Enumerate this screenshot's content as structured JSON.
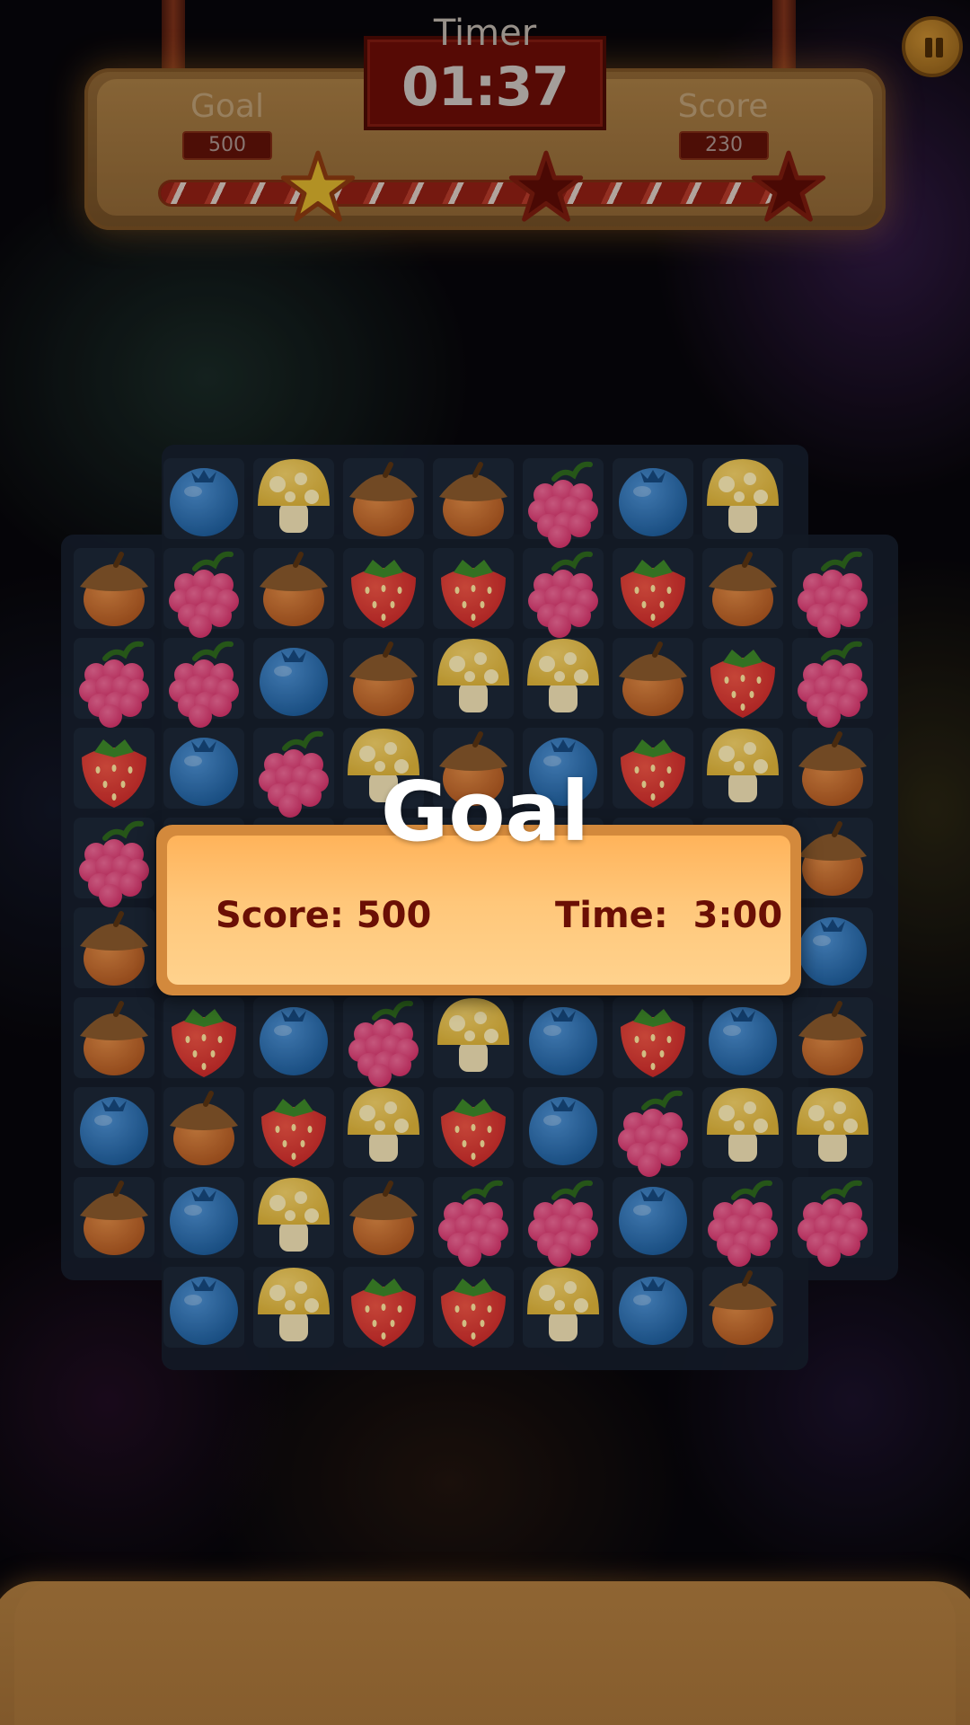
{
  "hud": {
    "timer_label": "Timer",
    "timer_value": "01:37",
    "goal_label": "Goal",
    "goal_value": "500",
    "score_label": "Score",
    "score_value": "230",
    "stars_earned": 1,
    "stars_total": 3
  },
  "overlay": {
    "title": "Goal",
    "score_text": "Score: 500",
    "time_text": "Time:  3:00"
  },
  "board": {
    "rows": [
      [
        null,
        "blueberry",
        "mushroom",
        "acorn",
        "acorn",
        "raspberry",
        "blueberry",
        "mushroom",
        null
      ],
      [
        "acorn",
        "raspberry",
        "acorn",
        "strawberry",
        "strawberry",
        "raspberry",
        "strawberry",
        "acorn",
        "raspberry"
      ],
      [
        "raspberry",
        "raspberry",
        "blueberry",
        "acorn",
        "mushroom",
        "mushroom",
        "acorn",
        "strawberry",
        "raspberry"
      ],
      [
        "strawberry",
        "blueberry",
        "raspberry",
        "mushroom",
        "acorn",
        "blueberry",
        "strawberry",
        "mushroom",
        "acorn"
      ],
      [
        "raspberry",
        "",
        "",
        "",
        "",
        "",
        "",
        "",
        "acorn"
      ],
      [
        "acorn",
        "",
        "",
        "",
        "",
        "",
        "",
        "",
        "blueberry"
      ],
      [
        "acorn",
        "strawberry",
        "blueberry",
        "raspberry",
        "mushroom",
        "blueberry",
        "strawberry",
        "blueberry",
        "acorn"
      ],
      [
        "blueberry",
        "acorn",
        "strawberry",
        "mushroom",
        "strawberry",
        "blueberry",
        "raspberry",
        "mushroom",
        "mushroom"
      ],
      [
        "acorn",
        "blueberry",
        "mushroom",
        "acorn",
        "raspberry",
        "raspberry",
        "blueberry",
        "raspberry",
        "raspberry"
      ],
      [
        null,
        "blueberry",
        "mushroom",
        "strawberry",
        "strawberry",
        "mushroom",
        "blueberry",
        "acorn",
        null
      ]
    ]
  },
  "colors": {
    "blueberry": "#1f5f9e",
    "raspberry": "#d8336b",
    "acorn": "#b35a22",
    "strawberry": "#cf2a2a",
    "mushroom": "#e0b53a",
    "goal_text": "#6b0f05"
  }
}
